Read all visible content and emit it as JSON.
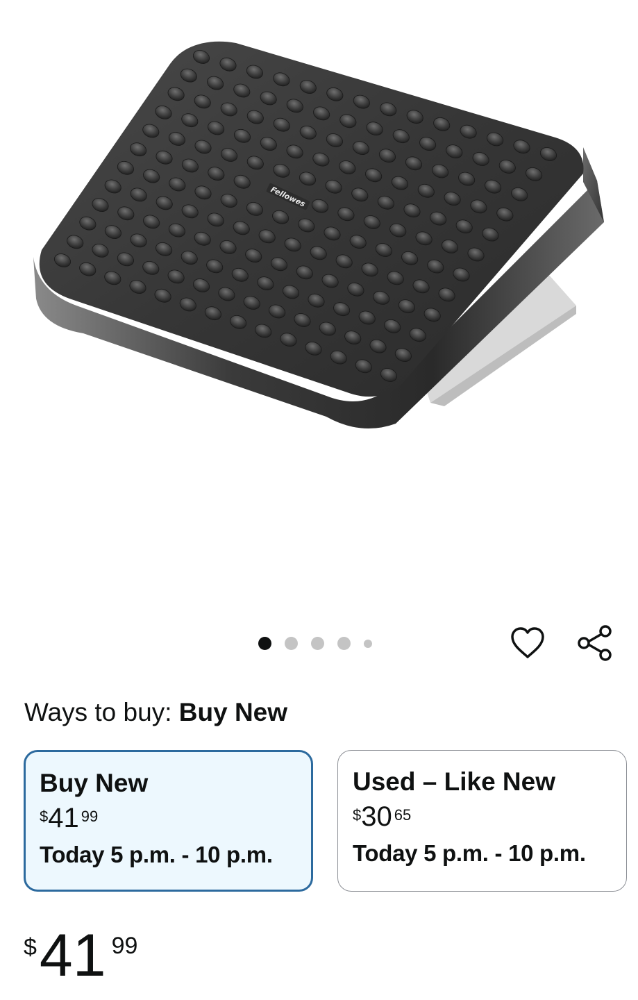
{
  "product": {
    "image_alt": "Fellowes adjustable foot rest with massaging bumps",
    "image_brand_mark": "Fellowes"
  },
  "carousel": {
    "dots": [
      {
        "state": "active"
      },
      {
        "state": "inactive"
      },
      {
        "state": "inactive"
      },
      {
        "state": "inactive"
      },
      {
        "state": "inactive-small"
      }
    ]
  },
  "actions": {
    "favorite_icon": "heart-icon",
    "share_icon": "share-icon"
  },
  "ways_to_buy": {
    "label": "Ways to buy:",
    "selected": "Buy New",
    "options": [
      {
        "title": "Buy New",
        "price_symbol": "$",
        "price_whole": "41",
        "price_fraction": "99",
        "delivery": "Today 5 p.m. - 10 p.m.",
        "selected": true
      },
      {
        "title": "Used – Like New",
        "price_symbol": "$",
        "price_whole": "30",
        "price_fraction": "65",
        "delivery": "Today 5 p.m. - 10 p.m.",
        "selected": false
      }
    ]
  },
  "price": {
    "symbol": "$",
    "whole": "41",
    "fraction": "99"
  },
  "colors": {
    "selected_card_bg": "#edf8fe",
    "selected_card_border": "#2c6a9e",
    "unselected_card_border": "#8d9096",
    "text": "#0f1111",
    "dot_active": "#0f1111",
    "dot_inactive": "#c4c4c4"
  }
}
